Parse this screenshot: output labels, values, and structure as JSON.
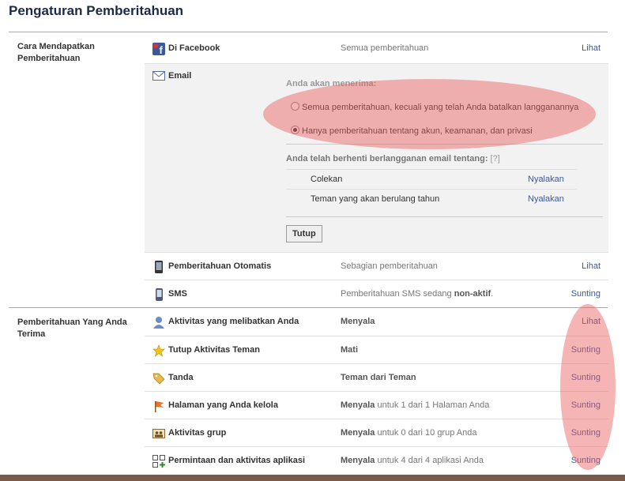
{
  "page": {
    "title": "Pengaturan Pemberitahuan"
  },
  "sections": {
    "how": "Cara Mendapatkan Pemberitahuan",
    "receive": "Pemberitahuan Yang Anda Terima"
  },
  "facebook": {
    "name": "Di Facebook",
    "value": "Semua pemberitahuan",
    "action": "Lihat"
  },
  "email": {
    "name": "Email",
    "receive_title": "Anda akan menerima:",
    "options": [
      {
        "label": "Semua pemberitahuan, kecuali yang telah Anda batalkan langganannya",
        "selected": false
      },
      {
        "label": "Hanya pemberitahuan tentang akun, keamanan, dan privasi",
        "selected": true
      }
    ],
    "unsub_title": "Anda telah berhenti berlangganan email tentang:",
    "unsub_help": "[?]",
    "unsub": [
      {
        "name": "Colekan",
        "action": "Nyalakan"
      },
      {
        "name": "Teman yang akan berulang tahun",
        "action": "Nyalakan"
      }
    ],
    "close_label": "Tutup"
  },
  "push": {
    "name": "Pemberitahuan Otomatis",
    "value": "Sebagian pemberitahuan",
    "action": "Lihat"
  },
  "sms": {
    "name": "SMS",
    "value_pre": "Pemberitahuan SMS sedang",
    "value_bold": "non-aktif",
    "value_post": ".",
    "action": "Sunting"
  },
  "receive_rows": [
    {
      "name": "Aktivitas yang melibatkan Anda",
      "state": "Menyala",
      "detail": "",
      "action": "Lihat",
      "icon": "person-icon"
    },
    {
      "name": "Tutup Aktivitas Teman",
      "state": "Mati",
      "detail": "",
      "action": "Sunting",
      "icon": "star-icon"
    },
    {
      "name": "Tanda",
      "state": "Teman dari Teman",
      "detail": "",
      "action": "Sunting",
      "icon": "tag-icon"
    },
    {
      "name": "Halaman yang Anda kelola",
      "state": "Menyala",
      "detail": "untuk 1 dari 1 Halaman Anda",
      "action": "Sunting",
      "icon": "flag-icon"
    },
    {
      "name": "Aktivitas grup",
      "state": "Menyala",
      "detail": "untuk 0 dari 10 grup Anda",
      "action": "Sunting",
      "icon": "group-icon"
    },
    {
      "name": "Permintaan dan aktivitas aplikasi",
      "state": "Menyala",
      "detail": "untuk 4 dari 4 aplikasi Anda",
      "action": "Sunting",
      "icon": "apps-icon"
    }
  ],
  "colors": {
    "link": "#3b5998",
    "highlight": "#eb5a5a"
  }
}
